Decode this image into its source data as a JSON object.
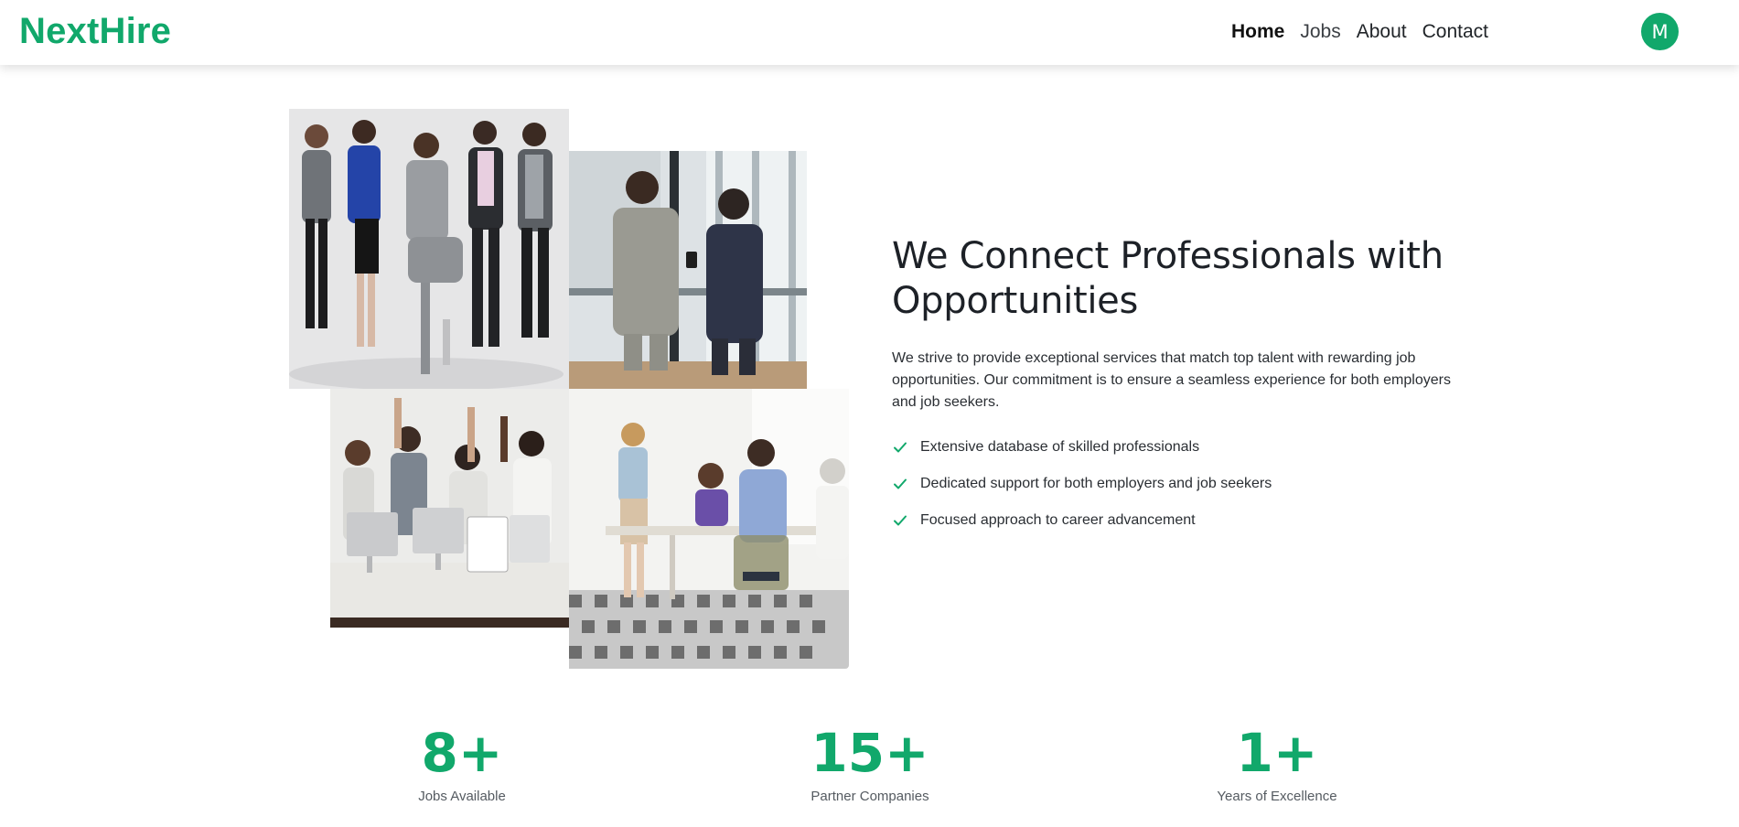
{
  "nav": {
    "brand": "NextHire",
    "links": [
      {
        "label": "Home"
      },
      {
        "label": "Jobs"
      },
      {
        "label": "About"
      },
      {
        "label": "Contact"
      }
    ],
    "avatar_initial": "M"
  },
  "hero": {
    "title": "We Connect Professionals with Opportunities",
    "description": "We strive to provide exceptional services that match top talent with rewarding job opportunities. Our commitment is to ensure a seamless experience for both employers and job seekers.",
    "features": [
      "Extensive database of skilled professionals",
      "Dedicated support for both employers and job seekers",
      "Focused approach to career advancement"
    ]
  },
  "stats": [
    {
      "value": "8+",
      "label": "Jobs Available"
    },
    {
      "value": "15+",
      "label": "Partner Companies"
    },
    {
      "value": "1+",
      "label": "Years of Excellence"
    }
  ],
  "colors": {
    "accent": "#11a86b",
    "text": "#212529"
  },
  "icons": {
    "feature_bullet": "check-icon"
  }
}
